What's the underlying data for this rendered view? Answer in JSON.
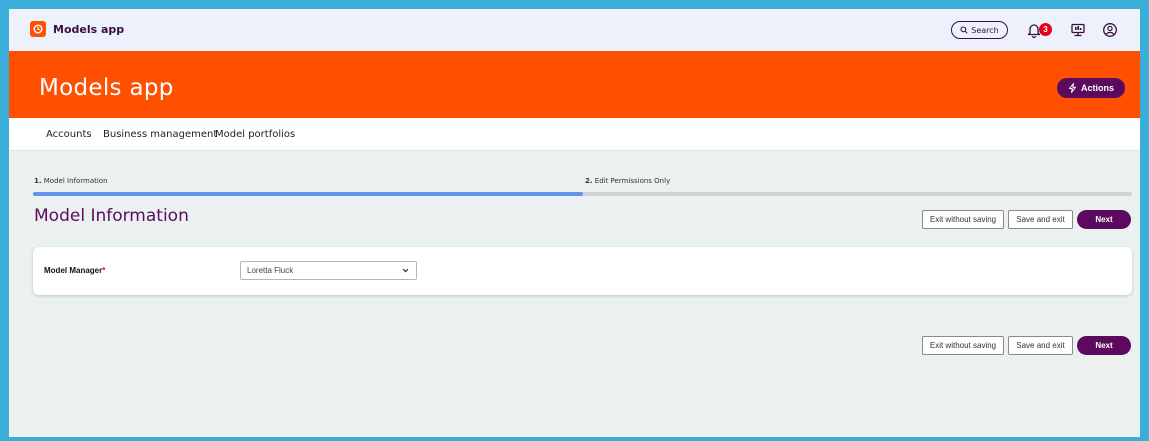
{
  "header": {
    "app_name": "Models app",
    "search_label": "Search",
    "notification_count": "3"
  },
  "banner": {
    "title": "Models app",
    "actions_label": "Actions"
  },
  "nav": {
    "items": [
      {
        "label": "Accounts"
      },
      {
        "label": "Business management"
      },
      {
        "label": "Model portfolios"
      }
    ]
  },
  "stepper": {
    "steps": [
      {
        "number": "1.",
        "label": "Model Information"
      },
      {
        "number": "2.",
        "label": "Edit Permissions Only"
      }
    ],
    "progress_percent": 50
  },
  "form": {
    "title": "Model Information",
    "exit_label": "Exit without saving",
    "save_exit_label": "Save and exit",
    "next_label": "Next",
    "field_label": "Model Manager",
    "required_mark": "*",
    "field_value": "Loretta Fluck"
  },
  "colors": {
    "brand_orange": "#fe5000",
    "brand_purple": "#5c0a5e",
    "progress_blue": "#6395f0",
    "frame_border": "#3aaed8"
  }
}
